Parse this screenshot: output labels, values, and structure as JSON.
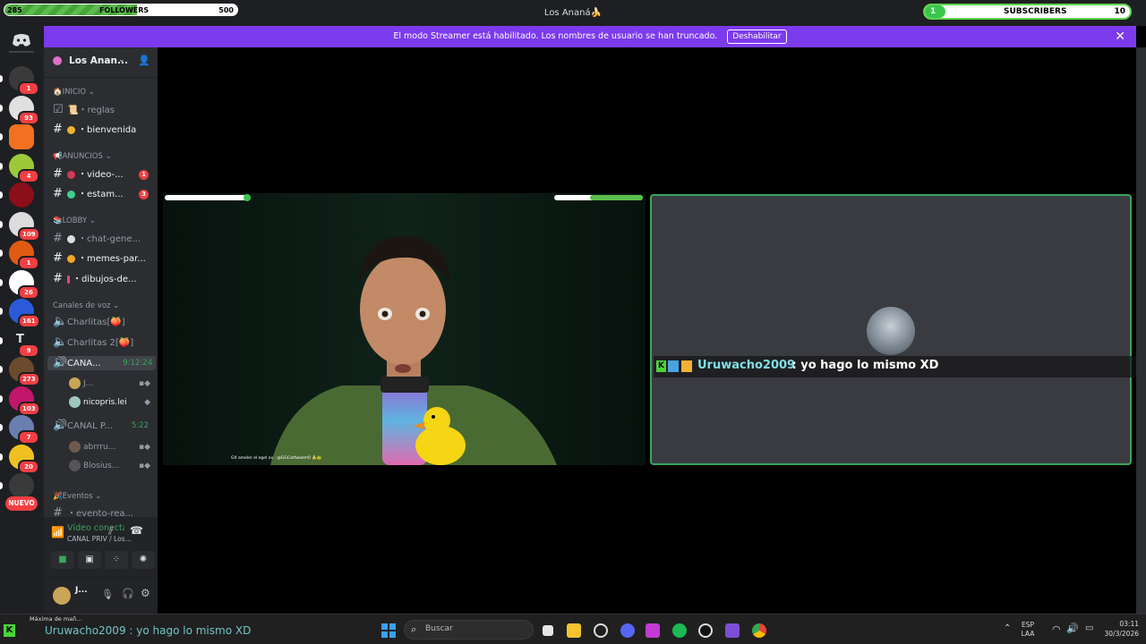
{
  "overlay": {
    "followers": {
      "left_count": "285",
      "label": "FOLLOWERS",
      "goal": "500",
      "progress": 0.57
    },
    "subscribers": {
      "count": "1",
      "label": "SUBSCRIBERS",
      "goal": "10",
      "progress": 0.1
    }
  },
  "window": {
    "title": "Los Ananá🍌"
  },
  "banner": {
    "text": "El modo Streamer está habilitado. Los nombres de usuario se han truncado.",
    "button": "Deshabilitar",
    "close": "✕"
  },
  "servers": [
    {
      "badge": "1"
    },
    {
      "badge": "93"
    },
    {
      "badge": ""
    },
    {
      "badge": "4"
    },
    {
      "badge": ""
    },
    {
      "badge": "109"
    },
    {
      "badge": "1"
    },
    {
      "badge": "26"
    },
    {
      "badge": "161"
    },
    {
      "badge": "9",
      "letter": "T"
    },
    {
      "badge": "273"
    },
    {
      "badge": "103"
    },
    {
      "badge": "7"
    },
    {
      "badge": "20"
    },
    {
      "badge": ""
    }
  ],
  "new_label": "NUEVO",
  "sidebar": {
    "server_name": "Los Anan...",
    "categories": {
      "inicio": "🏠INICIO",
      "anuncios": "📢ANUNCIOS",
      "lobby": "📚LOBBY",
      "voz": "Canales de voz",
      "eventos": "🎉Eventos"
    },
    "channels": {
      "reglas": "📜・reglas",
      "bienvenida": "・bienvenida",
      "videos": "・video-...",
      "videos_badge": "1",
      "estam": "・estam...",
      "estam_badge": "3",
      "chat": "・chat-gene...",
      "memes": "・memes-par...",
      "dibujos": "・dibujos-de...",
      "evento": "・evento-rea..."
    },
    "voice": {
      "charlitas": "Charlitas[🍑]",
      "charlitas2": "Charlitas 2[🍑]",
      "canal": "CANA...",
      "canal_time": "9:12:24",
      "user1": "J...",
      "user2": "nicopris.lei",
      "canal_p": "CANAL P...",
      "canal_p_time": "5:22",
      "user3": "abrrru...",
      "user4": "Blosius..."
    }
  },
  "voice_panel": {
    "status": "Vídeo conectad",
    "channel": "CANAL PRIV / Los...",
    "user": "J..."
  },
  "stage": {
    "tile_name": "Uruwacho2009",
    "tile_message": " : yo hago lo mismo XD",
    "cam_caption": "GX ameler el egel xx : @GGCattwaem0 🍌🐸"
  },
  "taskbar": {
    "overlay_text": "Uruwacho2009 : yo hago lo mismo XD",
    "overlay_small": "Máxima de mañ...",
    "search_placeholder": "Buscar",
    "lang_top": "ESP",
    "lang_bottom": "LAA",
    "time": "03:11",
    "date": "30/3/2026"
  },
  "colors": {
    "accent": "#7c3aed",
    "green": "#3ba55d",
    "red": "#f23f43"
  }
}
